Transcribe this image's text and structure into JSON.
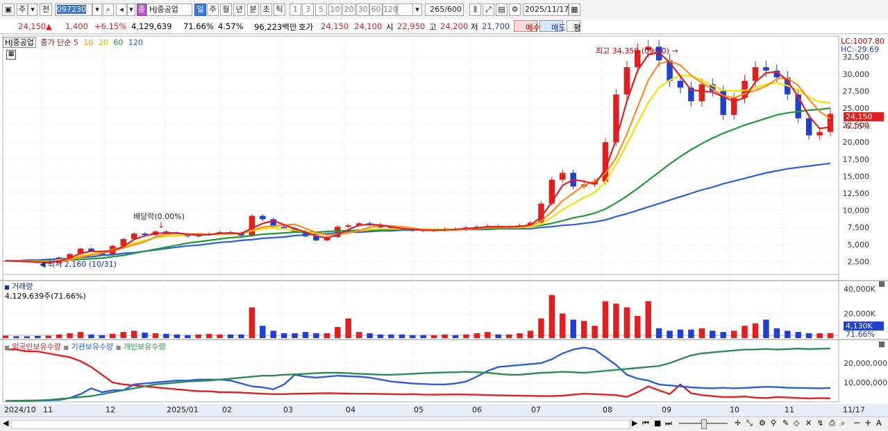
{
  "toolbar": {
    "market_label": "주",
    "prev_label": "전",
    "code_value": "097230",
    "stock_badge": "종",
    "stock_name": "HJ중공업",
    "period_tabs": [
      "일",
      "주",
      "월",
      "년",
      "분",
      "초",
      "틱"
    ],
    "active_period": "일",
    "intervals": [
      "1",
      "3",
      "5",
      "10",
      "20",
      "30",
      "60",
      "120"
    ],
    "count_value": "265",
    "count_total": "/600",
    "date_value": "2025/11/17"
  },
  "quote": {
    "price": "24,150",
    "change": "1,400",
    "change_pct": "+6.15%",
    "volume": "4,129,639",
    "volume_ratio": "71.66%",
    "turnover": "4.57%",
    "amount": "96,223백만",
    "ask_label": "호가",
    "ask1": "24,150",
    "ask2": "24,100",
    "open_label": "시",
    "open": "22,950",
    "high_label": "고",
    "high": "24,200",
    "low_label": "저",
    "low": "21,700",
    "buy_label": "매수",
    "sell_label": "매도",
    "eval_label": "평"
  },
  "price_panel": {
    "legend_name": "HJ중공업",
    "legend_ma": "종가 단순",
    "ma_labels": [
      "5",
      "10",
      "20",
      "60",
      "120"
    ],
    "lc": "LC:1007.80",
    "hc": "HC:-29.69",
    "current_price": "24,150",
    "current_pct": "6.15%",
    "high_note": "최고 34,350 (09/10)",
    "low_note": "최저 2,160 (10/31)",
    "dividend_note": "배당락(0.00%)",
    "y_ticks": [
      "32,500",
      "30,000",
      "27,500",
      "25,000",
      "22,500",
      "20,000",
      "17,500",
      "15,000",
      "12,500",
      "10,000",
      "7,500",
      "5,000",
      "2,500"
    ]
  },
  "volume_panel": {
    "title": "거래량",
    "value": "4,129,639주(71.66%)",
    "y_ticks": [
      "40,000K",
      "20,000K"
    ],
    "current": "4,130K",
    "current_pct": "71.66%"
  },
  "holding_panel": {
    "legend": [
      "외국인보유수량",
      "기관보유수량",
      "개인보유수량"
    ],
    "y_ticks": [
      "20,000,000",
      "10,000,000"
    ]
  },
  "x_axis": [
    "2024/10",
    "11",
    "12",
    "2025/01",
    "02",
    "03",
    "04",
    "05",
    "06",
    "07",
    "08",
    "09",
    "10",
    "11",
    "11/17"
  ],
  "colors": {
    "ma5": "#e02020",
    "ma10": "#ff8c1a",
    "ma20": "#f5e000",
    "ma60": "#1f9a3a",
    "ma120": "#2b5fd9",
    "up": "#e02020",
    "down": "#2040d0"
  },
  "chart_data": {
    "type": "candlestick",
    "price_close_approx": [
      2600,
      2500,
      2400,
      2300,
      2300,
      3100,
      3600,
      4400,
      4000,
      3500,
      4800,
      5800,
      6600,
      6400,
      6900,
      6700,
      6500,
      6200,
      6500,
      6600,
      6800,
      6700,
      6300,
      9200,
      8700,
      7600,
      7400,
      6900,
      6200,
      5600,
      6100,
      7600,
      7800,
      8100,
      7900,
      7500,
      7300,
      7200,
      7100,
      7000,
      7100,
      7300,
      7200,
      7500,
      7600,
      7700,
      7500,
      7600,
      7800,
      8200,
      11000,
      14500,
      15500,
      13500,
      13800,
      14200,
      20000,
      27000,
      31000,
      33500,
      34000,
      32000,
      29000,
      28000,
      26000,
      28500,
      27500,
      24000,
      26500,
      29000,
      31000,
      30500,
      29500,
      27000,
      23500,
      21000,
      21500,
      24150
    ],
    "ma20_approx": [
      2600,
      2600,
      2550,
      2500,
      2500,
      2700,
      3000,
      3300,
      3600,
      3800,
      4200,
      4700,
      5200,
      5600,
      6000,
      6200,
      6300,
      6400,
      6400,
      6500,
      6600,
      6600,
      6600,
      7000,
      7300,
      7400,
      7300,
      7100,
      6900,
      6600,
      6400,
      6500,
      6700,
      7000,
      7200,
      7300,
      7300,
      7300,
      7300,
      7200,
      7200,
      7200,
      7200,
      7300,
      7400,
      7500,
      7500,
      7500,
      7500,
      7600,
      8000,
      9000,
      10100,
      11000,
      11900,
      12600,
      14200,
      16800,
      19700,
      22800,
      25800,
      28000,
      29100,
      29800,
      29700,
      29100,
      28300,
      27600,
      27500,
      27600,
      28000,
      28500,
      28700,
      28300,
      27600,
      26600,
      25900,
      25800
    ],
    "ma60_approx": [
      2600,
      2600,
      2600,
      2600,
      2600,
      2600,
      2700,
      2800,
      2900,
      3000,
      3200,
      3400,
      3700,
      4000,
      4300,
      4600,
      4900,
      5200,
      5400,
      5600,
      5800,
      6000,
      6100,
      6300,
      6500,
      6600,
      6700,
      6800,
      6800,
      6800,
      6900,
      7000,
      7000,
      7100,
      7100,
      7100,
      7200,
      7200,
      7200,
      7200,
      7200,
      7200,
      7200,
      7200,
      7300,
      7300,
      7300,
      7400,
      7500,
      7600,
      7800,
      8100,
      8500,
      8900,
      9200,
      9600,
      10200,
      11100,
      12100,
      13200,
      14400,
      15600,
      16800,
      17900,
      18900,
      19800,
      20600,
      21300,
      21900,
      22500,
      23000,
      23500,
      24000,
      24300,
      24500,
      24700,
      24800,
      25000
    ],
    "ma120_approx": [
      2600,
      2600,
      2700,
      2700,
      2800,
      2900,
      3000,
      3100,
      3200,
      3400,
      3500,
      3700,
      3800,
      4000,
      4200,
      4400,
      4600,
      4800,
      4900,
      5100,
      5300,
      5400,
      5600,
      5700,
      5900,
      6000,
      6100,
      6300,
      6400,
      6500,
      6600,
      6700,
      6800,
      6800,
      6900,
      7000,
      7000,
      7100,
      7100,
      7200,
      7200,
      7200,
      7200,
      7200,
      7200,
      7200,
      7300,
      7300,
      7300,
      7300,
      7500,
      7600,
      7800,
      7900,
      8100,
      8300,
      8600,
      9100,
      9500,
      10000,
      10500,
      11000,
      11500,
      12000,
      12500,
      13000,
      13400,
      13900,
      14300,
      14700,
      15100,
      15500,
      15800,
      16100,
      16300,
      16500,
      16700,
      16900
    ],
    "volume_k_approx": [
      2000,
      1500,
      1500,
      1800,
      2000,
      3000,
      4000,
      5000,
      3000,
      2500,
      3500,
      5000,
      6000,
      4500,
      4000,
      3500,
      3000,
      2500,
      3000,
      3500,
      3000,
      3000,
      3000,
      25000,
      10000,
      6000,
      4000,
      4000,
      5000,
      4000,
      4000,
      9000,
      16000,
      5000,
      4000,
      3000,
      3000,
      3000,
      2500,
      2500,
      2500,
      3000,
      2500,
      3000,
      4000,
      5000,
      3000,
      3000,
      4000,
      6000,
      16000,
      35000,
      20000,
      15000,
      14000,
      10000,
      30000,
      28000,
      25000,
      18000,
      30000,
      8000,
      6000,
      7000,
      7000,
      8000,
      6000,
      5000,
      6000,
      10000,
      12000,
      15000,
      8000,
      6000,
      5000,
      4000,
      4000,
      4130
    ],
    "foreign_holding_approx": [
      27000000,
      27000000,
      26000000,
      26000000,
      25000000,
      24000000,
      23000000,
      21000000,
      18000000,
      14000000,
      10000000,
      9000000,
      8500000,
      8000000,
      7500000,
      7000000,
      6500000,
      6000000,
      5500000,
      5500000,
      5000000,
      5000000,
      4800000,
      4500000,
      4200000,
      4000000,
      4000000,
      4200000,
      4300000,
      4400000,
      4500000,
      4400000,
      4300000,
      4200000,
      4200000,
      4100000,
      4000000,
      3900000,
      4000000,
      3800000,
      3700000,
      3800000,
      3900000,
      3800000,
      3700000,
      3500000,
      3400000,
      3300000,
      3200000,
      3100000,
      3000000,
      3000000,
      3200000,
      3800000,
      4200000,
      4000000,
      3800000,
      3500000,
      2600000,
      5000000,
      8000000,
      6000000,
      4000000,
      9000000,
      4500000,
      3500000,
      3000000,
      2500000,
      2500000,
      2800000,
      2200000,
      2000000,
      2500000,
      2300000,
      2000000,
      1800000,
      2000000,
      1800000
    ],
    "institution_holding_approx": [
      500000,
      500000,
      500000,
      700000,
      800000,
      1000000,
      2000000,
      4000000,
      7000000,
      5000000,
      6000000,
      6000000,
      9000000,
      9500000,
      10000000,
      10500000,
      11000000,
      11000000,
      11500000,
      11500000,
      11500000,
      11000000,
      9500000,
      8000000,
      7500000,
      6500000,
      9000000,
      14000000,
      13000000,
      12500000,
      13000000,
      13500000,
      13200000,
      13000000,
      12500000,
      11500000,
      10500000,
      10000000,
      9500000,
      9200000,
      9000000,
      9000000,
      9500000,
      10500000,
      13000000,
      16000000,
      18000000,
      18500000,
      19000000,
      19500000,
      20000000,
      22000000,
      25000000,
      27000000,
      28000000,
      27000000,
      23000000,
      19000000,
      14000000,
      12000000,
      11000000,
      9000000,
      8500000,
      8000000,
      7500000,
      7200000,
      7000000,
      7300000,
      7000000,
      7200000,
      7500000,
      7800000,
      7600000,
      7300000,
      7200000,
      7100000,
      7000000,
      7200000
    ],
    "individual_holding_approx": [
      500000,
      600000,
      700000,
      800000,
      1000000,
      1500000,
      2000000,
      2500000,
      3000000,
      4000000,
      5000000,
      6000000,
      7000000,
      8000000,
      9000000,
      9500000,
      10000000,
      10500000,
      10800000,
      11000000,
      11500000,
      12000000,
      12500000,
      13000000,
      13500000,
      13500000,
      14000000,
      14200000,
      14500000,
      14800000,
      15000000,
      15000000,
      14800000,
      14500000,
      14300000,
      14000000,
      14000000,
      14200000,
      14500000,
      14800000,
      15000000,
      15200000,
      15300000,
      15500000,
      15300000,
      15000000,
      14500000,
      14000000,
      14000000,
      14500000,
      15000000,
      15200000,
      15500000,
      15300000,
      15000000,
      15500000,
      16000000,
      16500000,
      17000000,
      17500000,
      18000000,
      18500000,
      20000000,
      22000000,
      24000000,
      25000000,
      25500000,
      26000000,
      26500000,
      27000000,
      27000000,
      27300000,
      27000000,
      27200000,
      27500000,
      27200000,
      27400000,
      27500000
    ],
    "ylim_price": [
      0,
      34350
    ],
    "ylim_volume_k": [
      0,
      45000
    ],
    "ylim_holding": [
      0,
      30000000
    ]
  }
}
